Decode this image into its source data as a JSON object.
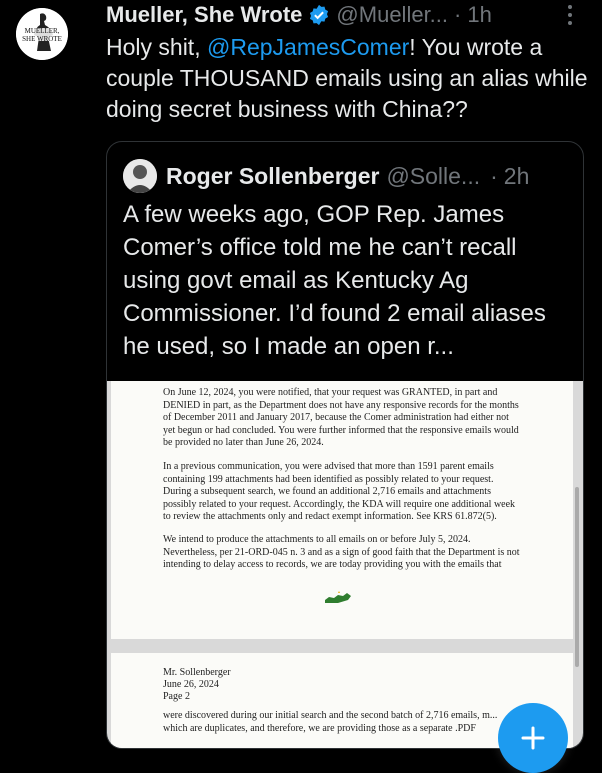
{
  "tweet": {
    "author_name": "Mueller, She Wrote",
    "handle": "@Mueller...",
    "separator": "·",
    "time": "1h",
    "avatar_text": "MUELLER, SHE WROTE",
    "text_before": "Holy shit, ",
    "mention": "@RepJamesComer",
    "text_after": "! You wrote a couple THOUSAND emails using an alias while doing secret business with China??"
  },
  "quote": {
    "author_name": "Roger Sollenberger",
    "handle": "@Solle...",
    "separator": "·",
    "time": "2h",
    "text": "A few weeks ago, GOP Rep. James Comer’s office told me he can’t recall using govt email as Kentucky Ag Commissioner. I’d found 2 email aliases he used, so I made an open r..."
  },
  "document": {
    "p1": "On June 12, 2024, you were notified, that your request was GRANTED, in part and DENIED in part, as the Department does not have any responsive records for the months of December 2011 and January 2017, because the Comer administration had either not yet begun or had concluded. You were further informed that the responsive emails would be provided no later than June 26, 2024.",
    "p2": "In a previous communication, you were advised that more than 1591 parent emails containing 199 attachments had been identified as possibly related to your request. During a subsequent search, we found an additional 2,716 emails and attachments possibly related to your request. Accordingly, the KDA will require one additional week to review the attachments only and redact exempt information. See KRS 61.872(5).",
    "p3": "We intend to produce the attachments to all emails on or before July 5, 2024. Nevertheless, per 21-ORD-045 n. 3 and as a sign of good faith that the Department is not intending to delay access to records, we are today providing you with the emails that",
    "page2_line1": "Mr. Sollenberger",
    "page2_line2": "June 26, 2024",
    "page2_line3": "Page 2",
    "p4": "were discovered during our initial search and the second batch of 2,716 emails, m... which are duplicates, and therefore, we are providing those as a separate .PDF"
  },
  "colors": {
    "accent": "#1d9bf0",
    "background": "#000000",
    "muted": "#71767b"
  }
}
